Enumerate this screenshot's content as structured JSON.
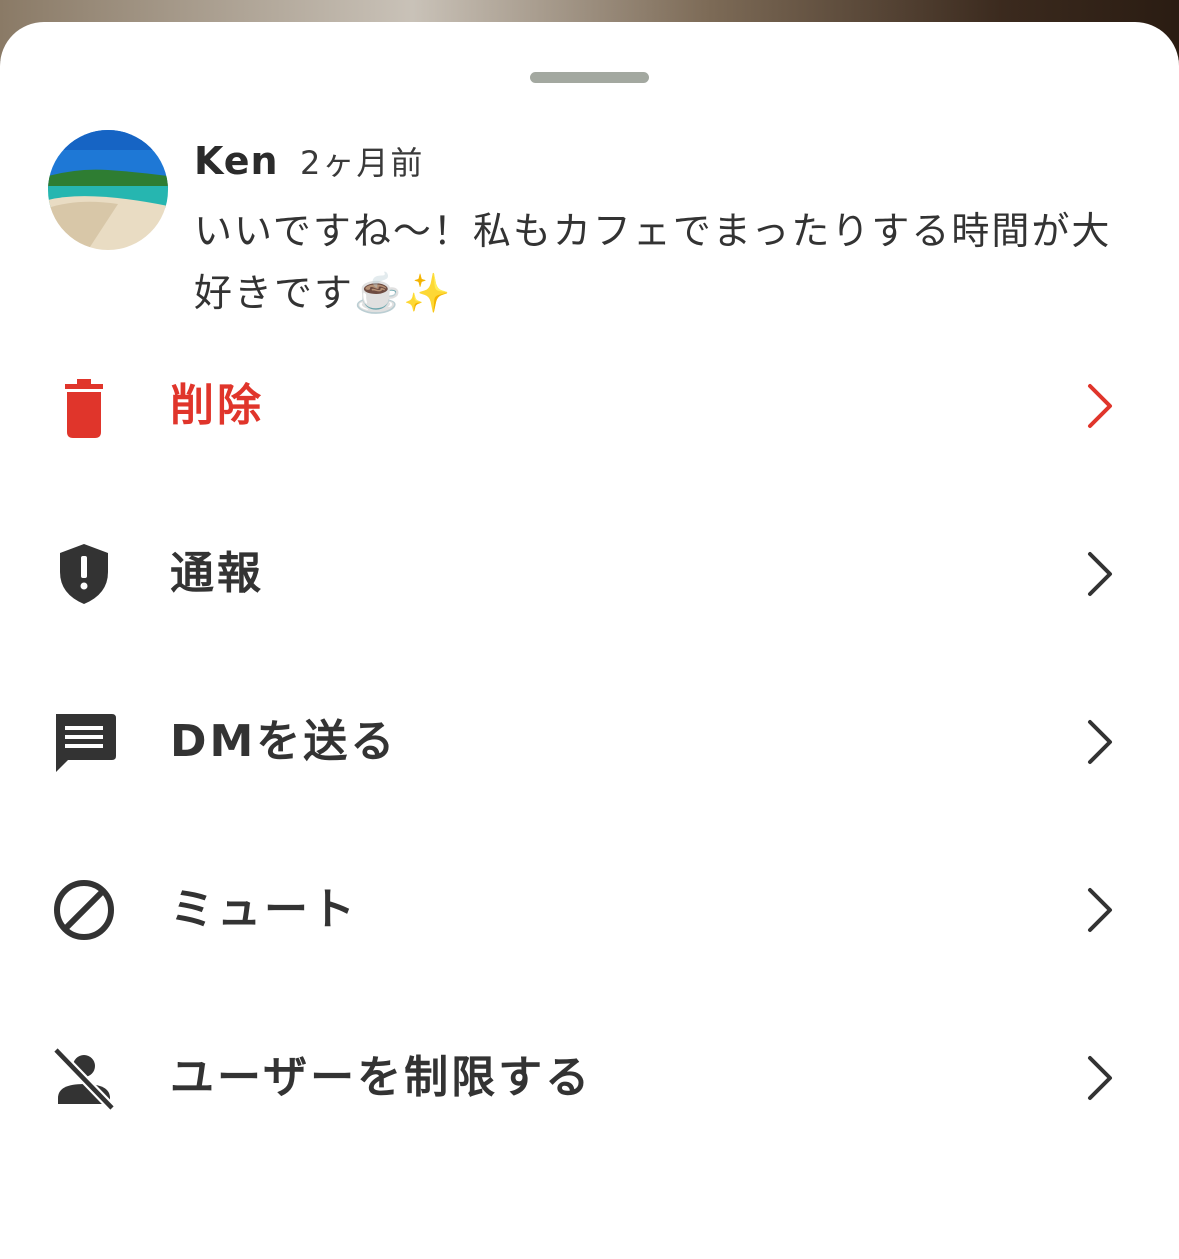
{
  "comment": {
    "author": "Ken",
    "time": "2ヶ月前",
    "text": "いいですね〜！私もカフェでまったりする時間が大好きです☕️✨"
  },
  "menu": {
    "items": [
      {
        "label": "削除",
        "icon": "trash-icon",
        "color": "#e0352b"
      },
      {
        "label": "通報",
        "icon": "shield-alert-icon",
        "color": "#333333"
      },
      {
        "label": "DMを送る",
        "icon": "message-icon",
        "color": "#333333"
      },
      {
        "label": "ミュート",
        "icon": "block-icon",
        "color": "#333333"
      },
      {
        "label": "ユーザーを制限する",
        "icon": "user-off-icon",
        "color": "#333333"
      }
    ]
  },
  "colors": {
    "danger": "#e0352b",
    "text": "#333333",
    "handle": "#a3a8a0"
  }
}
